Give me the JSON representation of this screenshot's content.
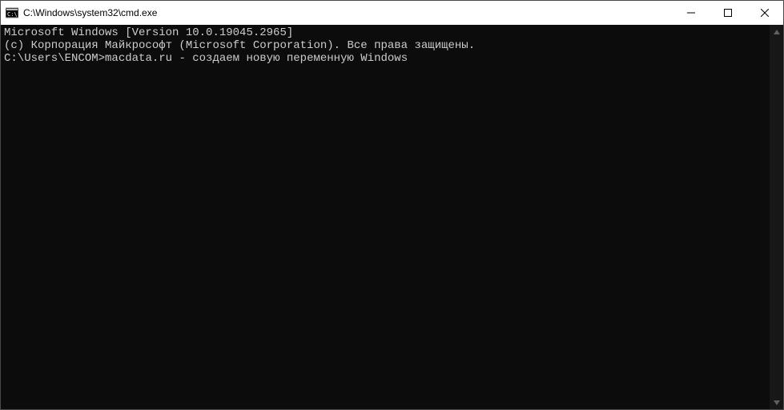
{
  "window": {
    "title": "C:\\Windows\\system32\\cmd.exe"
  },
  "terminal": {
    "line1": "Microsoft Windows [Version 10.0.19045.2965]",
    "line2": "(c) Корпорация Майкрософт (Microsoft Corporation). Все права защищены.",
    "blank": "",
    "prompt_path": "C:\\Users\\ENCOM>",
    "command": "macdata.ru - создаем новую переменную Windows"
  },
  "icons": {
    "app": "cmd-icon",
    "minimize": "minimize-icon",
    "maximize": "maximize-icon",
    "close": "close-icon",
    "scroll_up": "scroll-up-icon",
    "scroll_down": "scroll-down-icon"
  }
}
